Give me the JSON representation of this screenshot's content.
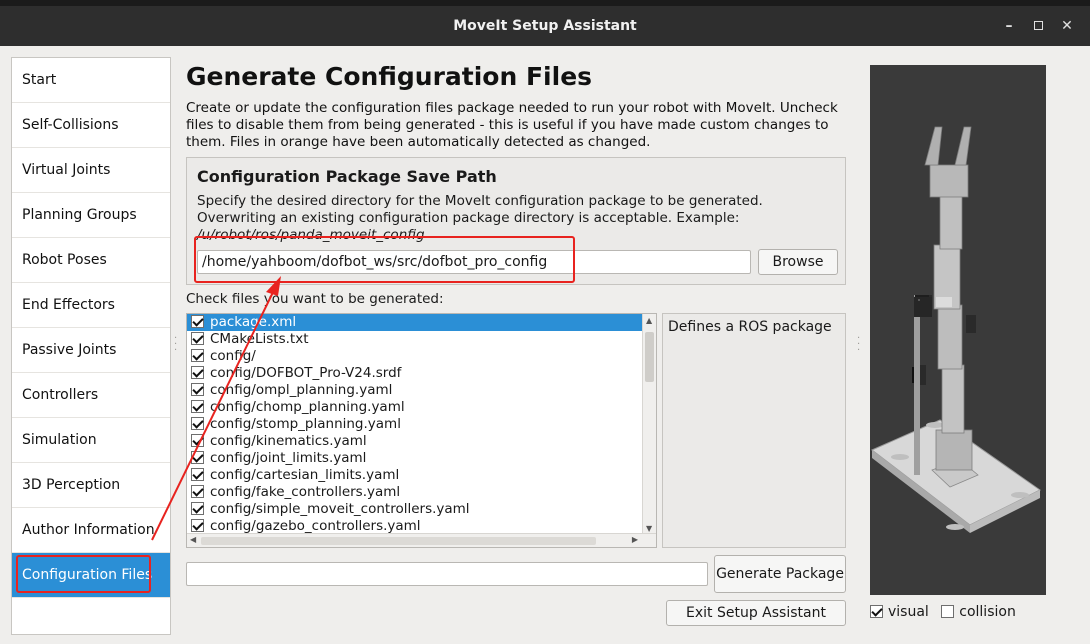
{
  "window": {
    "title": "MoveIt Setup Assistant",
    "minimize_glyph": "–",
    "close_glyph": "✕"
  },
  "sidebar": {
    "items": [
      {
        "label": "Start"
      },
      {
        "label": "Self-Collisions"
      },
      {
        "label": "Virtual Joints"
      },
      {
        "label": "Planning Groups"
      },
      {
        "label": "Robot Poses"
      },
      {
        "label": "End Effectors"
      },
      {
        "label": "Passive Joints"
      },
      {
        "label": "Controllers"
      },
      {
        "label": "Simulation"
      },
      {
        "label": "3D Perception"
      },
      {
        "label": "Author Information"
      },
      {
        "label": "Configuration Files",
        "active": true
      }
    ]
  },
  "main": {
    "title": "Generate Configuration Files",
    "description": "Create or update the configuration files package needed to run your robot with MoveIt. Uncheck files to disable them from being generated - this is useful if you have made custom changes to them. Files in orange have been automatically detected as changed.",
    "save_path": {
      "title": "Configuration Package Save Path",
      "description": "Specify the desired directory for the MoveIt configuration package to be generated. Overwriting an existing configuration package directory is acceptable. Example: ",
      "example": "/u/robot/ros/panda_moveit_config",
      "value": "/home/yahboom/dofbot_ws/src/dofbot_pro_config",
      "browse_label": "Browse"
    },
    "files_label": "Check files you want to be generated:",
    "files": [
      "package.xml",
      "CMakeLists.txt",
      "config/",
      "config/DOFBOT_Pro-V24.srdf",
      "config/ompl_planning.yaml",
      "config/chomp_planning.yaml",
      "config/stomp_planning.yaml",
      "config/kinematics.yaml",
      "config/joint_limits.yaml",
      "config/cartesian_limits.yaml",
      "config/fake_controllers.yaml",
      "config/simple_moveit_controllers.yaml",
      "config/gazebo_controllers.yaml"
    ],
    "file_description": "Defines a ROS package",
    "generate_label": "Generate Package",
    "exit_label": "Exit Setup Assistant"
  },
  "viewer": {
    "visual_label": "visual",
    "collision_label": "collision",
    "visual_checked": true,
    "collision_checked": false
  },
  "annotation": {
    "color": "#e8231f"
  }
}
